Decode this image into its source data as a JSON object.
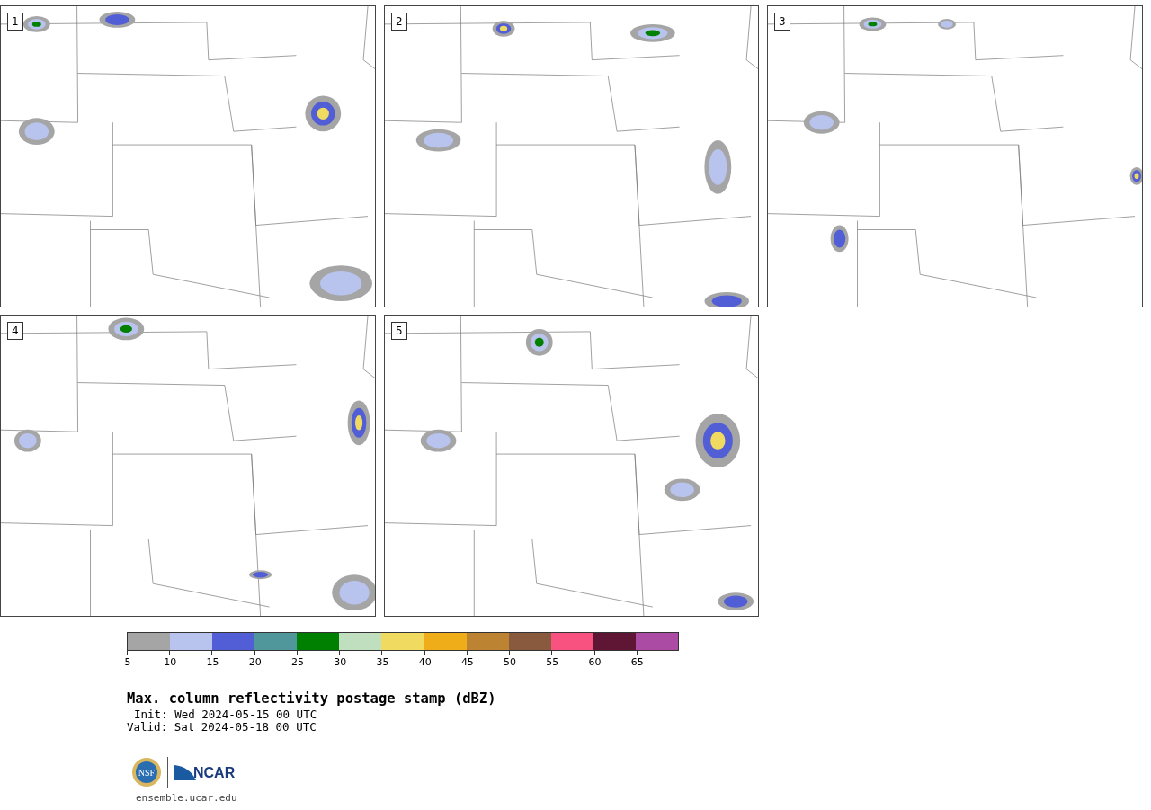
{
  "panels": [
    {
      "number": "1"
    },
    {
      "number": "2"
    },
    {
      "number": "3"
    },
    {
      "number": "4"
    },
    {
      "number": "5"
    }
  ],
  "colorbar": {
    "bins": [
      {
        "color": "#a5a5a5"
      },
      {
        "color": "#b8c3ee"
      },
      {
        "color": "#525ed6"
      },
      {
        "color": "#50979b"
      },
      {
        "color": "#008000"
      },
      {
        "color": "#c0dfbf"
      },
      {
        "color": "#f0da60"
      },
      {
        "color": "#f0ad1a"
      },
      {
        "color": "#bc8432"
      },
      {
        "color": "#8a5a3e"
      },
      {
        "color": "#f85280"
      },
      {
        "color": "#5e1634"
      },
      {
        "color": "#ab4ba3"
      }
    ],
    "ticks": [
      "5",
      "10",
      "15",
      "20",
      "25",
      "30",
      "35",
      "40",
      "45",
      "50",
      "55",
      "60",
      "65"
    ]
  },
  "title": "Max. column reflectivity postage stamp (dBZ)",
  "init": "Init: Wed 2024-05-15 00 UTC",
  "valid": "Valid: Sat 2024-05-18 00 UTC",
  "logos": [
    {
      "text": "NSF"
    },
    {
      "text": "NCAR"
    }
  ],
  "url": "ensemble.ucar.edu"
}
